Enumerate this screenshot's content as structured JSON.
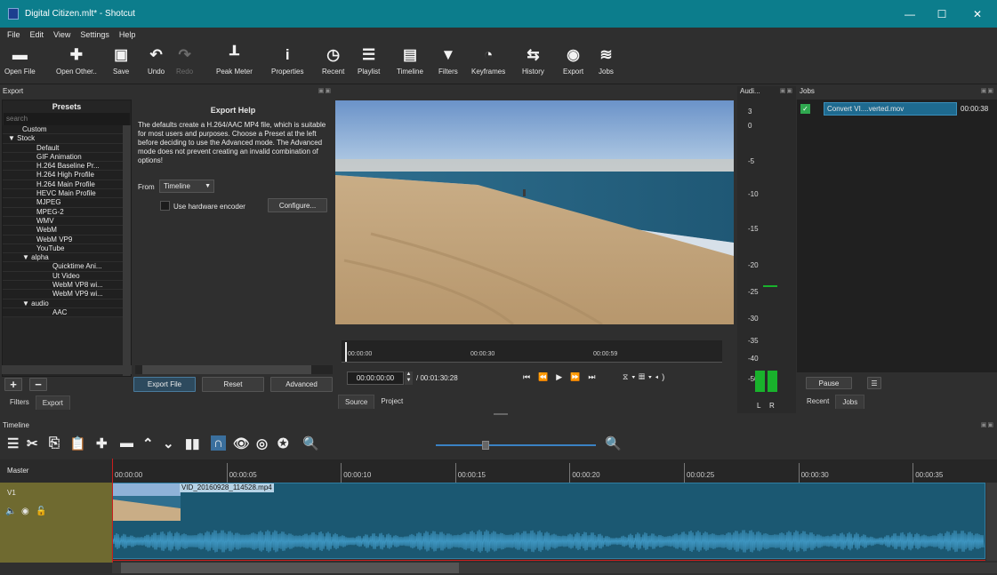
{
  "window": {
    "title": "Digital Citizen.mlt* - Shotcut",
    "minimize": "—",
    "maximize": "☐",
    "close": "✕"
  },
  "menu": [
    "File",
    "Edit",
    "View",
    "Settings",
    "Help"
  ],
  "toolbar": [
    {
      "label": "Open File",
      "icon": "folder-icon",
      "glyph": "▬"
    },
    {
      "label": "Open Other..",
      "icon": "open-other-icon",
      "glyph": "✚"
    },
    {
      "label": "Save",
      "icon": "save-icon",
      "glyph": "▣"
    },
    {
      "label": "Undo",
      "icon": "undo-icon",
      "glyph": "↶"
    },
    {
      "label": "Redo",
      "icon": "redo-icon",
      "glyph": "↷"
    },
    {
      "label": "Peak Meter",
      "icon": "peak-meter-icon",
      "glyph": "┸"
    },
    {
      "label": "Properties",
      "icon": "info-icon",
      "glyph": "i"
    },
    {
      "label": "Recent",
      "icon": "clock-icon",
      "glyph": "◷"
    },
    {
      "label": "Playlist",
      "icon": "list-icon",
      "glyph": "☰"
    },
    {
      "label": "Timeline",
      "icon": "timeline-icon",
      "glyph": "▤"
    },
    {
      "label": "Filters",
      "icon": "filter-icon",
      "glyph": "▼"
    },
    {
      "label": "Keyframes",
      "icon": "stopwatch-icon",
      "glyph": "◔"
    },
    {
      "label": "History",
      "icon": "history-icon",
      "glyph": "⇆"
    },
    {
      "label": "Export",
      "icon": "export-icon",
      "glyph": "◉"
    },
    {
      "label": "Jobs",
      "icon": "jobs-icon",
      "glyph": "≋"
    }
  ],
  "export": {
    "panel_title": "Export",
    "presets_header": "Presets",
    "search_placeholder": "search",
    "presets": [
      "Custom",
      "▼  Stock",
      "Default",
      "GIF Animation",
      "H.264 Baseline Pr...",
      "H.264 High Profile",
      "H.264 Main Profile",
      "HEVC Main Profile",
      "MJPEG",
      "MPEG-2",
      "WMV",
      "WebM",
      "WebM VP9",
      "YouTube",
      "▼  alpha",
      "Quicktime Ani...",
      "Ut Video",
      "WebM VP8 wi...",
      "WebM VP9 wi...",
      "▼  audio",
      "AAC"
    ],
    "help_title": "Export Help",
    "help_text": "The defaults create a H.264/AAC MP4 file, which is suitable for most users and purposes. Choose a Preset at the left before deciding to use the Advanced mode. The Advanced mode does not prevent creating an invalid combination of options!",
    "from_label": "From",
    "from_value": "Timeline",
    "hw_encoder_label": "Use hardware encoder",
    "configure_button": "Configure...",
    "export_file_button": "Export File",
    "reset_button": "Reset",
    "advanced_button": "Advanced",
    "add_button": "+",
    "remove_button": "−",
    "tabs": [
      "Filters",
      "Export"
    ]
  },
  "player": {
    "ruler_ticks": [
      "00:00:00",
      "00:00:30",
      "00:00:59"
    ],
    "position": "00:00:00:00",
    "duration": "/ 00:01:30:28",
    "tabs": [
      "Source",
      "Project"
    ]
  },
  "audio": {
    "title": "Audi...",
    "scale": [
      "3",
      "0",
      "-5",
      "-10",
      "-15",
      "-20",
      "-25",
      "-30",
      "-35",
      "-40",
      "-50"
    ],
    "left": "L",
    "right": "R"
  },
  "jobs": {
    "title": "Jobs",
    "items": [
      {
        "name": "Convert VI....verted.mov",
        "time": "00:00:38"
      }
    ],
    "pause_button": "Pause",
    "menu_button": "☰",
    "tabs": [
      "Recent",
      "Jobs"
    ]
  },
  "timeline": {
    "title": "Timeline",
    "master_label": "Master",
    "track_label": "V1",
    "ticks": [
      "00:00:00",
      "00:00:05",
      "00:00:10",
      "00:00:15",
      "00:00:20",
      "00:00:25",
      "00:00:30",
      "00:00:35"
    ],
    "clip_name": "VID_20160928_114528.mp4",
    "zoom_level": 0.3
  },
  "colors": {
    "titlebar": "#0c7d8c",
    "track_header": "#6f6a30",
    "clip": "#1b5872",
    "waveform": "#3e95c0",
    "playhead": "#c81e1e"
  }
}
